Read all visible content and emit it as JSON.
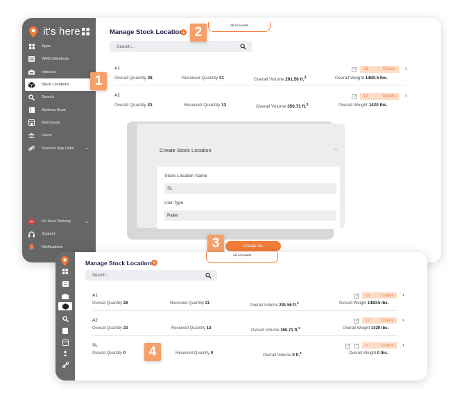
{
  "colors": {
    "accent": "#f27c3a",
    "accent_light": "#fdddc8",
    "sidebar": "#666666",
    "badge": "#f5a06a",
    "title": "#1d1d4a"
  },
  "app": {
    "brand": "it's here"
  },
  "sidebar": {
    "items": [
      {
        "label": "Apps",
        "icon": "apps-icon"
      },
      {
        "label": "WMS Manifests",
        "icon": "list-icon"
      },
      {
        "label": "Inbound",
        "icon": "truck-icon"
      },
      {
        "label": "Stock Locations",
        "icon": "box-icon",
        "active": true
      },
      {
        "label": "Search",
        "icon": "search-icon"
      },
      {
        "label": "Address Book",
        "icon": "book-icon"
      },
      {
        "label": "Merchants",
        "icon": "store-icon"
      },
      {
        "label": "Users",
        "icon": "users-icon"
      },
      {
        "label": "Scanner App Links",
        "icon": "link-icon",
        "chevron": "⌄"
      }
    ],
    "bottom": [
      {
        "label": "It's Here Delivery",
        "icon": "delivery-logo-icon",
        "chevron": "⌄"
      },
      {
        "label": "Support",
        "icon": "headset-icon"
      },
      {
        "label": "Notifications",
        "icon": "bell-icon"
      }
    ]
  },
  "page": {
    "title": "Manage Stock Locations",
    "plus": "+",
    "accounts_tab": "All Accounts",
    "search_placeholder": "Search..."
  },
  "locations": [
    {
      "name": "A1",
      "qty_label": "Overall Quantity",
      "qty": "28",
      "rec_label": "Received Quantity",
      "rec": "21",
      "vol_label": "Overall Volume",
      "vol": "291.56 ft.",
      "vol_sup": "3",
      "wt_label": "Overall Weight",
      "wt": "1480.5 lbs.",
      "orders_count": "16",
      "orders_label": "Orders",
      "arrow": "›"
    },
    {
      "name": "A2",
      "qty_label": "Overall Quantity",
      "qty": "23",
      "rec_label": "Received Quantity",
      "rec": "13",
      "vol_label": "Overall Volume",
      "vol": "350.71 ft.",
      "vol_sup": "3",
      "wt_label": "Overall Weight",
      "wt": "1420 lbs.",
      "orders_count": "12",
      "orders_label": "Orders",
      "arrow": "›"
    },
    {
      "name": "SL",
      "qty_label": "Overall Quantity",
      "qty": "0",
      "rec_label": "Received Quantity",
      "rec": "0",
      "vol_label": "Overall Volume",
      "vol": "0 ft.",
      "vol_sup": "3",
      "wt_label": "Overall Weight",
      "wt": "0 lbs.",
      "orders_count": "0",
      "orders_label": "Orders",
      "arrow": "›"
    }
  ],
  "modal": {
    "title": "Create Stock Location",
    "close": "×",
    "name_label": "Stock Location Name",
    "name_value": "SL",
    "type_label": "Unit Type",
    "type_value": "Pallet",
    "submit": "Create SL"
  },
  "step_badges": [
    "1",
    "2",
    "3",
    "4"
  ]
}
